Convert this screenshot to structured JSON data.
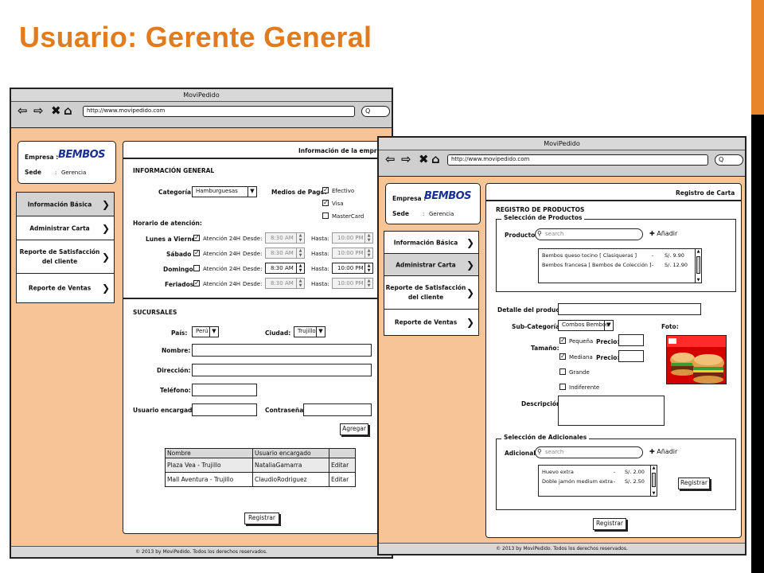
{
  "slide_title": "Usuario: Gerente General",
  "colors": {
    "title": "#e07b1f",
    "accent_bar": "#e8852a",
    "body_bg": "#f7c496"
  },
  "window1": {
    "title": "MoviPedido",
    "url": "http://www.movipedido.com",
    "search_icon": "Q",
    "company_label": "Empresa :",
    "company_logo": "BEMBOS",
    "sede_label": "Sede",
    "sede_sep": ":",
    "sede_value": "Gerencia",
    "nav": [
      {
        "label": "Información Básica"
      },
      {
        "label": "Administrar Carta"
      },
      {
        "label_line1": "Reporte de Satisfacción",
        "label_line2": "del cliente"
      },
      {
        "label": "Reporte de Ventas"
      }
    ],
    "panel_title": "Información de la empresa",
    "info_heading": "INFORMACIÓN GENERAL",
    "categoria_label": "Categoría:",
    "categoria_value": "Hamburguesas",
    "medios_label": "Medios de Pago:",
    "pagos": [
      "Efectivo",
      "Visa",
      "MasterCard"
    ],
    "horario_label": "Horario de atención:",
    "schedule": [
      {
        "day": "Lunes a Viernes",
        "check": "Atención 24H",
        "desde": "Desde:",
        "from": "8:30 AM",
        "hasta": "Hasta:",
        "to": "10:00 PM"
      },
      {
        "day": "Sábado",
        "check": "Atención 24H",
        "desde": "Desde:",
        "from": "8:30 AM",
        "hasta": "Hasta:",
        "to": "10:00 PM"
      },
      {
        "day": "Domingo",
        "check": "Atención 24H",
        "desde": "Desde:",
        "from": "8:30 AM",
        "hasta": "Hasta:",
        "to": "10:00 PM"
      },
      {
        "day": "Feriados",
        "check": "Atención 24H",
        "desde": "Desde:",
        "from": "8:30 AM",
        "hasta": "Hasta:",
        "to": "10:00 PM"
      }
    ],
    "sucursales_heading": "SUCURSALES",
    "pais_label": "País:",
    "pais_value": "Perú",
    "ciudad_label": "Ciudad:",
    "ciudad_value": "Trujillo",
    "nombre_label": "Nombre:",
    "direccion_label": "Dirección:",
    "telefono_label": "Teléfono:",
    "usuario_label": "Usuario encargado:",
    "contrasena_label": "Contraseña:",
    "agregar_label": "Agregar",
    "table_headers": [
      "Nombre",
      "Usuario encargado",
      ""
    ],
    "table_rows": [
      [
        "Plaza Vea - Trujillo",
        "NataliaGamarra",
        "Editar"
      ],
      [
        "Mall Aventura - Trujillo",
        "ClaudioRodriguez",
        "Editar"
      ]
    ],
    "registrar_label": "Registrar",
    "footer": "© 2013 by MoviPedido. Todos los derechos reservados."
  },
  "window2": {
    "title": "MoviPedido",
    "url": "http://www.movipedido.com",
    "search_icon": "Q",
    "company_label": "Empresa :",
    "company_logo": "BEMBOS",
    "sede_label": "Sede",
    "sede_sep": ":",
    "sede_value": "Gerencia",
    "nav": [
      {
        "label": "Información Básica"
      },
      {
        "label": "Administrar Carta"
      },
      {
        "label_line1": "Reporte de Satisfacción",
        "label_line2": "del cliente"
      },
      {
        "label": "Reporte de Ventas"
      }
    ],
    "panel_title": "Registro de Carta",
    "heading": "REGISTRO DE PRODUCTOS",
    "group1_title": "Selección de Productos",
    "productos_label": "Productos:",
    "search_placeholder": "search",
    "anadir_label": "Añadir",
    "products": [
      {
        "name": "Bembos queso tocino [ Clasiqueras ]",
        "dash": "-",
        "price": "S/.  9.90"
      },
      {
        "name": "Bembos francesa [ Bembos de Colección ]",
        "dash": "-",
        "price": "S/.  12.90"
      }
    ],
    "detalle_label": "Detalle del producto:",
    "subcat_label": "Sub-Categoría:",
    "subcat_value": "Combos Bembos",
    "foto_label": "Foto:",
    "tamano_label": "Tamaño:",
    "sizes": [
      "Pequeña",
      "Mediana",
      "Grande",
      "Indiferente"
    ],
    "precio_label": "Precio:",
    "descripcion_label": "Descripción:",
    "group2_title": "Selección de Adicionales",
    "adicional_label": "Adicional:",
    "adicionales": [
      {
        "name": "Huevo extra",
        "dash": "-",
        "price": "S/.  2.00"
      },
      {
        "name": "Doble jamón medium extra",
        "dash": "-",
        "price": "S/.  2.50"
      }
    ],
    "registrar_small": "Registrar",
    "registrar_label": "Registrar",
    "footer": "© 2013 by MoviPedido. Todos los derechos reservados."
  }
}
